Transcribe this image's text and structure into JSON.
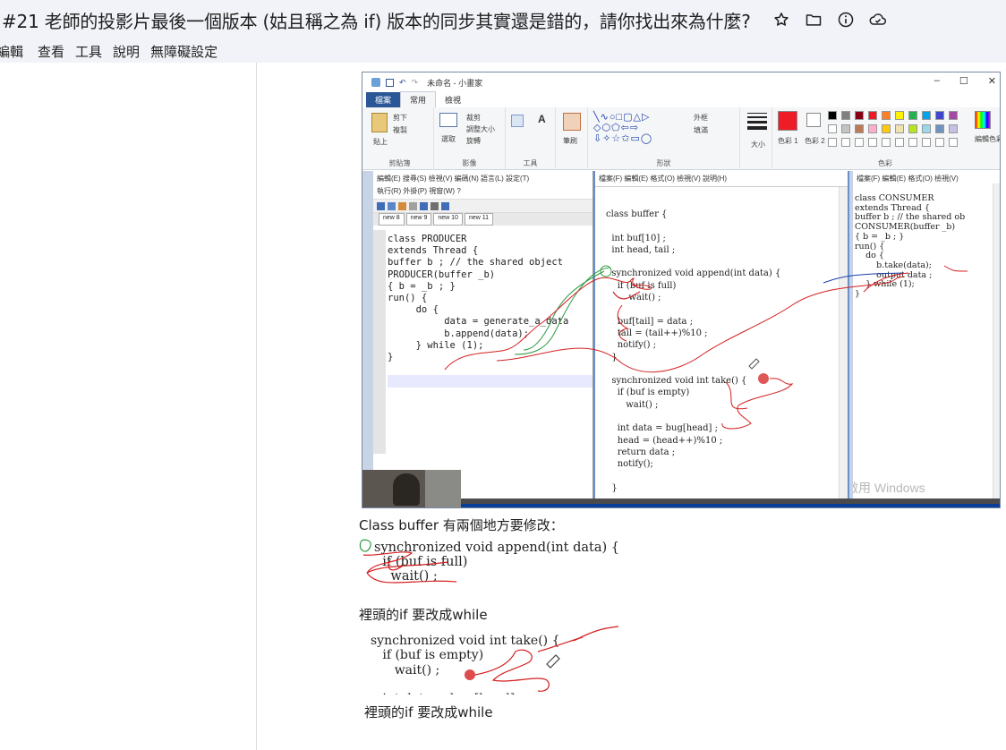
{
  "window": {
    "title": "#21 老師的投影片最後一個版本 (姑且稱之為 if) 版本的同步其實還是錯的，請你找出來為什麼?",
    "icons": [
      "star-icon",
      "folder-icon",
      "info-icon",
      "cloud-sync-icon"
    ]
  },
  "menu": {
    "items": [
      "編輯",
      "查看",
      "工具",
      "說明",
      "無障礙設定"
    ]
  },
  "screenshot": {
    "paint_title": "未命名 - 小畫家",
    "ribbon_tabs": [
      "檔案",
      "常用",
      "檢視"
    ],
    "ribbon_groups": {
      "clipboard": "剪貼簿",
      "image": "影像",
      "tools": "工具",
      "shapes": "形狀",
      "colors": "色彩"
    },
    "ribbon_labels": {
      "paste": "貼上",
      "cut": "剪下",
      "copy": "複製",
      "select": "選取",
      "crop": "裁剪",
      "resize": "調整大小",
      "rotate": "旋轉",
      "brushes": "筆刷",
      "outline": "外框",
      "fill": "填滿",
      "size": "大小",
      "color1": "色彩 1",
      "color2": "色彩 2",
      "edit_colors": "編輯色彩"
    },
    "left_editor": {
      "menu1": "編輯(E)  搜尋(S)  檢視(V)  編碼(N)  語言(L)  設定(T)",
      "menu2": "執行(R)  外掛(P)  視窗(W)  ?",
      "tabs": [
        "new 8",
        "new 9",
        "new 10",
        "new 11"
      ],
      "code": "class PRODUCER\nextends Thread {\nbuffer b ; // the shared object\nPRODUCER(buffer _b)\n{ b = _b ; }\nrun() {\n     do {\n          data = generate_a_data\n          b.append(data);\n     } while (1);\n}"
    },
    "middle_editor": {
      "menu": "檔案(F)  編輯(E)  格式(O)  檢視(V)  說明(H)",
      "code": "class buffer {\n\n  int buf[10] ;\n  int head, tail ;\n\n  synchronized void append(int data) {\n    if (buf is full)\n        wait() ;\n\n    buf[tail] = data ;\n    tail = (tail++)%10 ;\n    notify() ;\n  }\n\n  synchronized void int take() {\n    if (buf is empty)\n       wait() ;\n\n    int data = bug[head] ;\n    head = (head++)%10 ;\n    return data ;\n    notify();\n\n  }"
    },
    "right_editor": {
      "menu": "檔案(F)  編輯(E)  格式(O)  檢視(V)",
      "code": "class CONSUMER\nextends Thread {\nbuffer b ; // the shared ob\nCONSUMER(buffer _b)\n{ b = _b ; }\nrun() {\n    do {\n        b.take(data);\n        output data ;\n    } while (1);\n}"
    },
    "watermark": "啟用 Windows"
  },
  "caption1": "Class buffer 有兩個地方要修改：",
  "crop1": {
    "code": "synchronized void append(int data) {\n  if (buf is full)\n    wait() ;"
  },
  "caption2": "裡頭的if 要改成while",
  "crop2": {
    "code": "synchronized void int take() {\n   if (buf is empty)\n      wait() ;\n\n   int data = bug[head]"
  },
  "caption3": "裡頭的if 要改成while",
  "colors": {
    "annotation_red": "#d42020",
    "annotation_green": "#2e9b43",
    "annotation_blue": "#1b3fa8",
    "paint_file_tab": "#2b5797"
  }
}
